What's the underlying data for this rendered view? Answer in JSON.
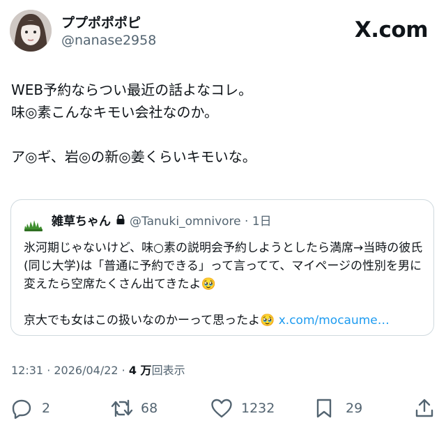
{
  "author": {
    "display_name": "ププポポポピ",
    "handle": "@nanase2958"
  },
  "brand": {
    "logo_text": "X.com"
  },
  "tweet": {
    "text": "WEB予約ならつい最近の話よなコレ。\n味◎素こんなキモい会社なのか。\n\nア◎ギ、岩◎の新◎姜くらいキモいな。"
  },
  "quoted_tweet": {
    "author_name": "雑草ちゃん",
    "handle": "@Tanuki_omnivore",
    "separator": " · ",
    "time": "1日",
    "text_part1": "氷河期じゃないけど、味○素の説明会予約しようとしたら満席→当時の彼氏(同じ大学)は「普通に予約できる」って言ってて、マイページの性別を男に変えたら空席たくさん出てきたよ🥹\n\n京大でも女はこの扱いなのかーって思ったよ🥹 ",
    "link_text": "x.com/mocaume…"
  },
  "meta": {
    "timestamp": "12:31 · 2026/04/22 · ",
    "views_count": "4 万",
    "views_label": "回表示"
  },
  "actions": {
    "replies": "2",
    "reposts": "68",
    "likes": "1232",
    "bookmarks": "29"
  },
  "colors": {
    "text_primary": "#0f1419",
    "text_secondary": "#536471",
    "link": "#1d9bf0",
    "border": "#cfd9de"
  }
}
